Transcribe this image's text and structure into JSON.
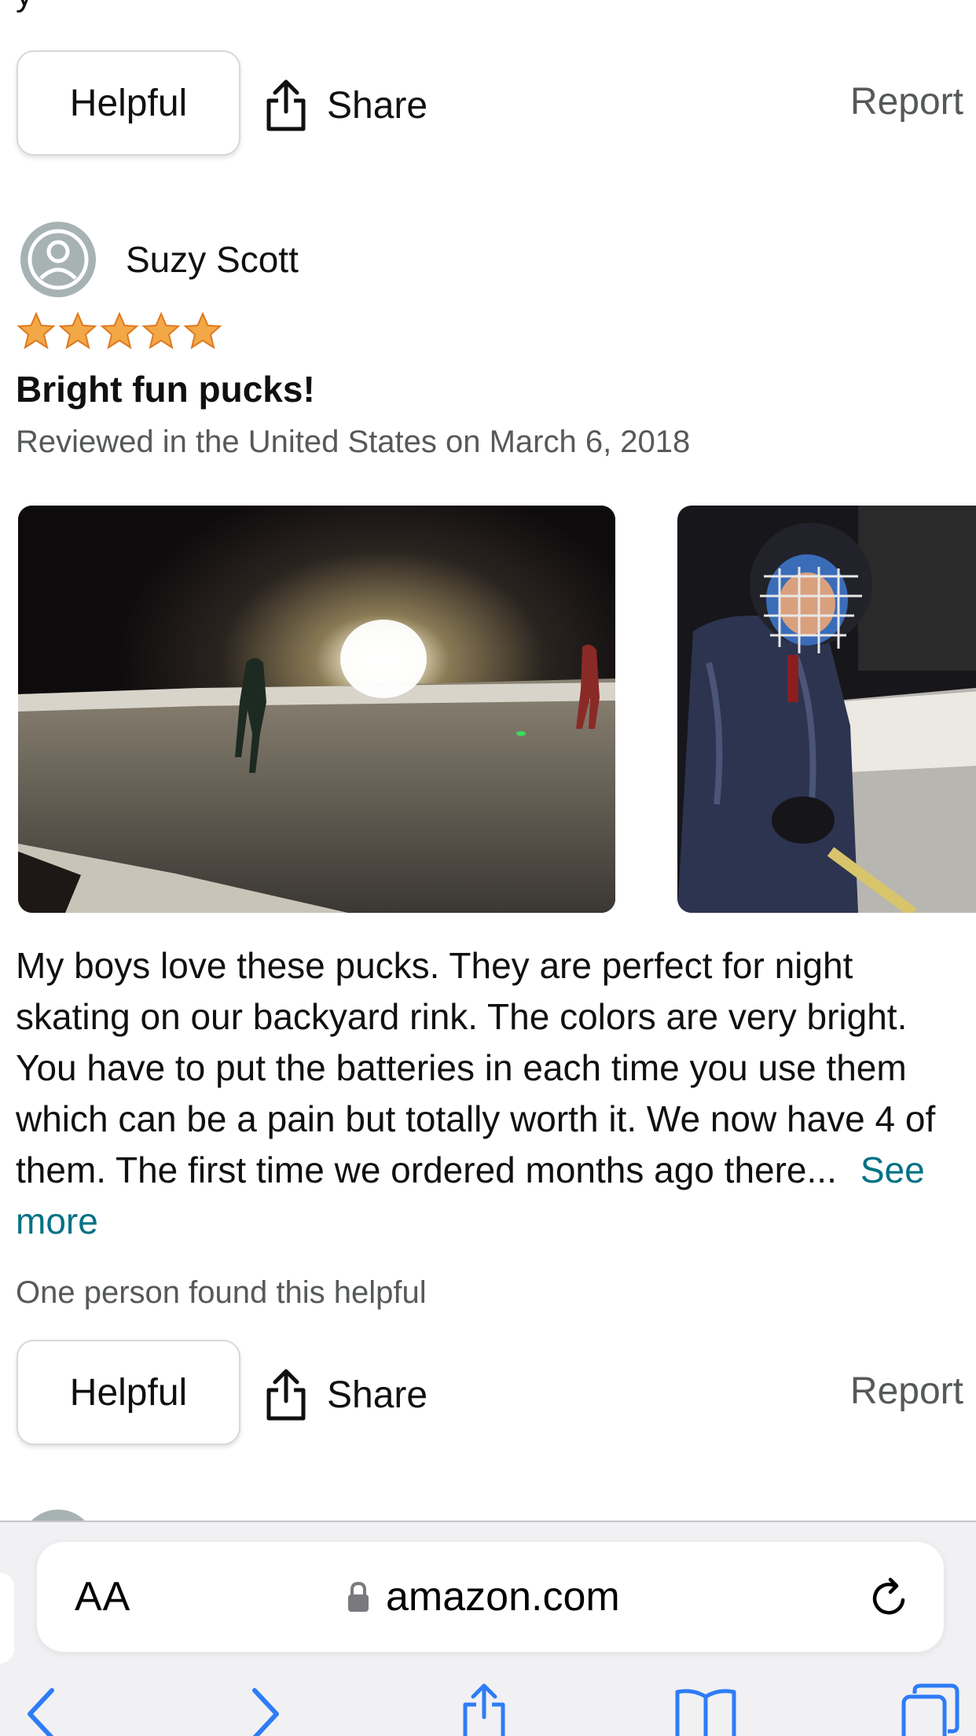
{
  "top_action_row": {
    "helpful_label": "Helpful",
    "share_label": "Share",
    "report_label": "Report"
  },
  "review": {
    "reviewer_name": "Suzy Scott",
    "rating": 5,
    "rating_max": 5,
    "title": "Bright fun pucks!",
    "meta": "Reviewed in the United States on March 6, 2018",
    "images": [
      {
        "description": "night-rink-skaters"
      },
      {
        "description": "child-hockey-helmet"
      }
    ],
    "body": "My boys love these pucks. They are perfect for night skating on our backyard rink. The colors are very bright. You have to put the batteries in each time you use them which can be a pain but totally worth it. We now have 4 of them. The first time we ordered months ago there...",
    "see_more_label": "See more",
    "helpful_count_text": "One person found this helpful",
    "helpful_label": "Helpful",
    "share_label": "Share",
    "report_label": "Report"
  },
  "browser": {
    "text_size_label": "AA",
    "url": "amazon.com",
    "icons": [
      "lock-icon",
      "reload-icon",
      "back-icon",
      "forward-icon",
      "share-icon",
      "bookmarks-icon",
      "tabs-icon"
    ]
  },
  "colors": {
    "star": "#f3a847",
    "link": "#007185",
    "secondary_text": "#565959",
    "toolbar_blue": "#2e7cf6"
  }
}
